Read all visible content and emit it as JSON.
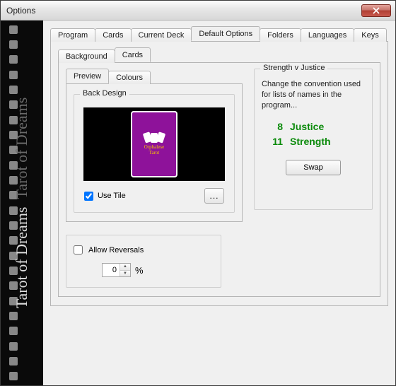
{
  "window": {
    "title": "Options"
  },
  "sidebar": {
    "brand_text": "Tarot of Dreams",
    "brand_repeat": "Tarot of Dreams"
  },
  "tabs_main": [
    {
      "label": "Program"
    },
    {
      "label": "Cards"
    },
    {
      "label": "Current Deck"
    },
    {
      "label": "Default Options"
    },
    {
      "label": "Folders"
    },
    {
      "label": "Languages"
    },
    {
      "label": "Keys"
    }
  ],
  "tabs_sub": [
    {
      "label": "Background"
    },
    {
      "label": "Cards"
    }
  ],
  "tabs_preview": [
    {
      "label": "Preview"
    },
    {
      "label": "Colours"
    }
  ],
  "back_design": {
    "legend": "Back Design",
    "card_text_line1": "Orphalese",
    "card_text_line2": "Tarot",
    "use_tile_label": "Use Tile",
    "use_tile_checked": true,
    "browse_label": "..."
  },
  "strength_v_justice": {
    "legend": "Strength v Justice",
    "description": "Change the convention used for lists of names in the program...",
    "row1_num": "8",
    "row1_name": "Justice",
    "row2_num": "11",
    "row2_name": "Strength",
    "swap_label": "Swap"
  },
  "reversals": {
    "label": "Allow Reversals",
    "checked": false,
    "value": "0",
    "suffix": "%"
  }
}
